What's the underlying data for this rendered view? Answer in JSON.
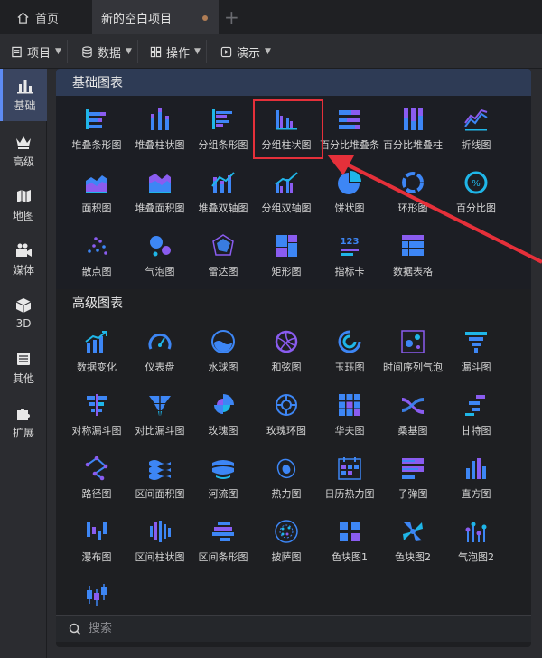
{
  "tabs": {
    "home_label": "首页",
    "active_label": "新的空白项目",
    "new_tab": "+"
  },
  "menubar": {
    "items": [
      {
        "label": "项目",
        "icon": "file-icon"
      },
      {
        "label": "数据",
        "icon": "database-icon"
      },
      {
        "label": "操作",
        "icon": "grid-icon"
      },
      {
        "label": "演示",
        "icon": "play-icon"
      }
    ]
  },
  "sidebar": {
    "items": [
      {
        "label": "基础",
        "icon": "bar-chart-icon",
        "active": true
      },
      {
        "label": "高级",
        "icon": "crown-icon"
      },
      {
        "label": "地图",
        "icon": "map-icon"
      },
      {
        "label": "媒体",
        "icon": "video-icon"
      },
      {
        "label": "3D",
        "icon": "cube-icon"
      },
      {
        "label": "其他",
        "icon": "list-icon"
      },
      {
        "label": "扩展",
        "icon": "puzzle-icon"
      }
    ]
  },
  "basic": {
    "title": "基础图表",
    "items": [
      {
        "label": "堆叠条形图",
        "icon": "stacked-bar-horizontal-icon"
      },
      {
        "label": "堆叠柱状图",
        "icon": "stacked-column-icon"
      },
      {
        "label": "分组条形图",
        "icon": "grouped-bar-horizontal-icon"
      },
      {
        "label": "分组柱状图",
        "icon": "grouped-column-icon"
      },
      {
        "label": "百分比堆叠条",
        "icon": "percent-stacked-bar-icon"
      },
      {
        "label": "百分比堆叠柱",
        "icon": "percent-stacked-column-icon"
      },
      {
        "label": "折线图",
        "icon": "line-chart-icon"
      },
      {
        "label": "面积图",
        "icon": "area-chart-icon"
      },
      {
        "label": "堆叠面积图",
        "icon": "stacked-area-icon"
      },
      {
        "label": "堆叠双轴图",
        "icon": "stacked-dual-axis-icon"
      },
      {
        "label": "分组双轴图",
        "icon": "grouped-dual-axis-icon"
      },
      {
        "label": "饼状图",
        "icon": "pie-chart-icon"
      },
      {
        "label": "环形图",
        "icon": "ring-chart-icon"
      },
      {
        "label": "百分比图",
        "icon": "percent-ring-icon"
      },
      {
        "label": "散点图",
        "icon": "scatter-icon"
      },
      {
        "label": "气泡图",
        "icon": "bubble-icon"
      },
      {
        "label": "雷达图",
        "icon": "radar-icon"
      },
      {
        "label": "矩形图",
        "icon": "treemap-icon"
      },
      {
        "label": "指标卡",
        "icon": "kpi-card-icon",
        "glyph": "123"
      },
      {
        "label": "数据表格",
        "icon": "table-icon"
      }
    ]
  },
  "advanced": {
    "title": "高级图表",
    "items": [
      {
        "label": "数据变化",
        "icon": "data-change-icon"
      },
      {
        "label": "仪表盘",
        "icon": "gauge-icon"
      },
      {
        "label": "水球图",
        "icon": "liquid-fill-icon"
      },
      {
        "label": "和弦图",
        "icon": "chord-icon"
      },
      {
        "label": "玉珏图",
        "icon": "radial-bar-icon"
      },
      {
        "label": "时间序列气泡",
        "icon": "timeline-bubble-icon"
      },
      {
        "label": "漏斗图",
        "icon": "funnel-icon"
      },
      {
        "label": "对称漏斗图",
        "icon": "symmetric-funnel-icon"
      },
      {
        "label": "对比漏斗图",
        "icon": "compare-funnel-icon"
      },
      {
        "label": "玫瑰图",
        "icon": "rose-icon"
      },
      {
        "label": "玫瑰环图",
        "icon": "rose-ring-icon"
      },
      {
        "label": "华夫图",
        "icon": "waffle-icon"
      },
      {
        "label": "桑基图",
        "icon": "sankey-icon"
      },
      {
        "label": "甘特图",
        "icon": "gantt-icon"
      },
      {
        "label": "路径图",
        "icon": "path-icon"
      },
      {
        "label": "区间面积图",
        "icon": "range-area-icon"
      },
      {
        "label": "河流图",
        "icon": "streamgraph-icon"
      },
      {
        "label": "热力图",
        "icon": "heatmap-icon"
      },
      {
        "label": "日历热力图",
        "icon": "calendar-heatmap-icon"
      },
      {
        "label": "子弹图",
        "icon": "bullet-icon"
      },
      {
        "label": "直方图",
        "icon": "histogram-icon"
      },
      {
        "label": "瀑布图",
        "icon": "waterfall-icon"
      },
      {
        "label": "区间柱状图",
        "icon": "range-column-icon"
      },
      {
        "label": "区间条形图",
        "icon": "range-bar-icon"
      },
      {
        "label": "披萨图",
        "icon": "pizza-icon"
      },
      {
        "label": "色块图1",
        "icon": "color-block-1-icon"
      },
      {
        "label": "色块图2",
        "icon": "color-block-2-icon"
      },
      {
        "label": "气泡图2",
        "icon": "lollipop-icon"
      },
      {
        "label": "",
        "icon": "candlestick-icon"
      }
    ]
  },
  "search": {
    "placeholder": "搜索"
  },
  "colors": {
    "accent_blue": "#3d86f5",
    "accent_purple": "#8a5cf0",
    "accent_cyan": "#1fb6e8",
    "highlight_red": "#e5303a"
  }
}
